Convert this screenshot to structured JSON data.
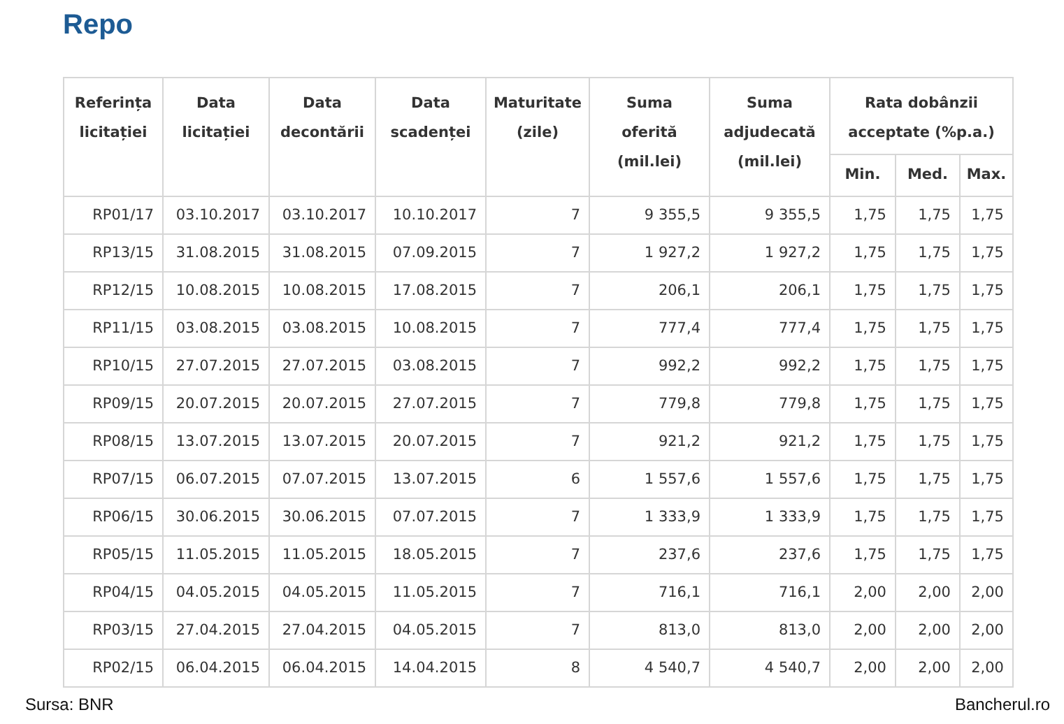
{
  "title": "Repo",
  "columns": [
    "Referința\nlicitației",
    "Data\nlicitației",
    "Data\ndecontării",
    "Data\nscadenței",
    "Maturitate\n(zile)",
    "Suma\noferită\n(mil.lei)",
    "Suma\nadjudecată\n(mil.lei)"
  ],
  "group_column": {
    "label": "Rata dobânzii\nacceptate (%p.a.)",
    "sub_columns": [
      "Min.",
      "Med.",
      "Max."
    ]
  },
  "rows": [
    [
      "RP01/17",
      "03.10.2017",
      "03.10.2017",
      "10.10.2017",
      "7",
      "9 355,5",
      "9 355,5",
      "1,75",
      "1,75",
      "1,75"
    ],
    [
      "RP13/15",
      "31.08.2015",
      "31.08.2015",
      "07.09.2015",
      "7",
      "1 927,2",
      "1 927,2",
      "1,75",
      "1,75",
      "1,75"
    ],
    [
      "RP12/15",
      "10.08.2015",
      "10.08.2015",
      "17.08.2015",
      "7",
      "206,1",
      "206,1",
      "1,75",
      "1,75",
      "1,75"
    ],
    [
      "RP11/15",
      "03.08.2015",
      "03.08.2015",
      "10.08.2015",
      "7",
      "777,4",
      "777,4",
      "1,75",
      "1,75",
      "1,75"
    ],
    [
      "RP10/15",
      "27.07.2015",
      "27.07.2015",
      "03.08.2015",
      "7",
      "992,2",
      "992,2",
      "1,75",
      "1,75",
      "1,75"
    ],
    [
      "RP09/15",
      "20.07.2015",
      "20.07.2015",
      "27.07.2015",
      "7",
      "779,8",
      "779,8",
      "1,75",
      "1,75",
      "1,75"
    ],
    [
      "RP08/15",
      "13.07.2015",
      "13.07.2015",
      "20.07.2015",
      "7",
      "921,2",
      "921,2",
      "1,75",
      "1,75",
      "1,75"
    ],
    [
      "RP07/15",
      "06.07.2015",
      "07.07.2015",
      "13.07.2015",
      "6",
      "1 557,6",
      "1 557,6",
      "1,75",
      "1,75",
      "1,75"
    ],
    [
      "RP06/15",
      "30.06.2015",
      "30.06.2015",
      "07.07.2015",
      "7",
      "1 333,9",
      "1 333,9",
      "1,75",
      "1,75",
      "1,75"
    ],
    [
      "RP05/15",
      "11.05.2015",
      "11.05.2015",
      "18.05.2015",
      "7",
      "237,6",
      "237,6",
      "1,75",
      "1,75",
      "1,75"
    ],
    [
      "RP04/15",
      "04.05.2015",
      "04.05.2015",
      "11.05.2015",
      "7",
      "716,1",
      "716,1",
      "2,00",
      "2,00",
      "2,00"
    ],
    [
      "RP03/15",
      "27.04.2015",
      "27.04.2015",
      "04.05.2015",
      "7",
      "813,0",
      "813,0",
      "2,00",
      "2,00",
      "2,00"
    ],
    [
      "RP02/15",
      "06.04.2015",
      "06.04.2015",
      "14.04.2015",
      "8",
      "4 540,7",
      "4 540,7",
      "2,00",
      "2,00",
      "2,00"
    ]
  ],
  "footer": {
    "source": "Sursa: BNR",
    "site": "Bancherul.ro"
  }
}
